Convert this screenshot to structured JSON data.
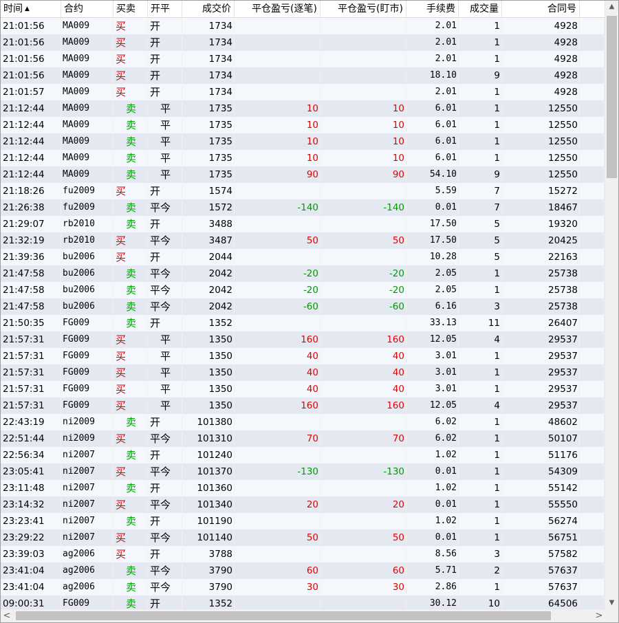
{
  "columns": {
    "time": "时间",
    "contract": "合约",
    "direction": "买卖",
    "offset": "开平",
    "price": "成交价",
    "pnl_trade": "平仓盈亏(逐笔)",
    "pnl_market": "平仓盈亏(盯市)",
    "fee": "手续费",
    "volume": "成交量",
    "contract_id": "合同号"
  },
  "sort": {
    "column": "time",
    "icon": "sort-ascending-icon",
    "glyph": "▲"
  },
  "icons": {
    "scroll_up": "▲",
    "scroll_down": "▼",
    "scroll_left": "<",
    "scroll_right": ">"
  },
  "colors": {
    "buy": "#d40000",
    "sell": "#00a000",
    "profit": "#e00000",
    "loss": "#009900"
  },
  "rows": [
    {
      "time": "21:01:56",
      "contract": "MA009",
      "direction": "买",
      "offset": "开",
      "price": "1734",
      "pnl_trade": "",
      "pnl_market": "",
      "fee": "2.01",
      "volume": "1",
      "contract_id": "4928"
    },
    {
      "time": "21:01:56",
      "contract": "MA009",
      "direction": "买",
      "offset": "开",
      "price": "1734",
      "pnl_trade": "",
      "pnl_market": "",
      "fee": "2.01",
      "volume": "1",
      "contract_id": "4928"
    },
    {
      "time": "21:01:56",
      "contract": "MA009",
      "direction": "买",
      "offset": "开",
      "price": "1734",
      "pnl_trade": "",
      "pnl_market": "",
      "fee": "2.01",
      "volume": "1",
      "contract_id": "4928"
    },
    {
      "time": "21:01:56",
      "contract": "MA009",
      "direction": "买",
      "offset": "开",
      "price": "1734",
      "pnl_trade": "",
      "pnl_market": "",
      "fee": "18.10",
      "volume": "9",
      "contract_id": "4928"
    },
    {
      "time": "21:01:57",
      "contract": "MA009",
      "direction": "买",
      "offset": "开",
      "price": "1734",
      "pnl_trade": "",
      "pnl_market": "",
      "fee": "2.01",
      "volume": "1",
      "contract_id": "4928"
    },
    {
      "time": "21:12:44",
      "contract": "MA009",
      "direction": "卖",
      "offset": "平",
      "price": "1735",
      "pnl_trade": "10",
      "pnl_market": "10",
      "fee": "6.01",
      "volume": "1",
      "contract_id": "12550"
    },
    {
      "time": "21:12:44",
      "contract": "MA009",
      "direction": "卖",
      "offset": "平",
      "price": "1735",
      "pnl_trade": "10",
      "pnl_market": "10",
      "fee": "6.01",
      "volume": "1",
      "contract_id": "12550"
    },
    {
      "time": "21:12:44",
      "contract": "MA009",
      "direction": "卖",
      "offset": "平",
      "price": "1735",
      "pnl_trade": "10",
      "pnl_market": "10",
      "fee": "6.01",
      "volume": "1",
      "contract_id": "12550"
    },
    {
      "time": "21:12:44",
      "contract": "MA009",
      "direction": "卖",
      "offset": "平",
      "price": "1735",
      "pnl_trade": "10",
      "pnl_market": "10",
      "fee": "6.01",
      "volume": "1",
      "contract_id": "12550"
    },
    {
      "time": "21:12:44",
      "contract": "MA009",
      "direction": "卖",
      "offset": "平",
      "price": "1735",
      "pnl_trade": "90",
      "pnl_market": "90",
      "fee": "54.10",
      "volume": "9",
      "contract_id": "12550"
    },
    {
      "time": "21:18:26",
      "contract": "fu2009",
      "direction": "买",
      "offset": "开",
      "price": "1574",
      "pnl_trade": "",
      "pnl_market": "",
      "fee": "5.59",
      "volume": "7",
      "contract_id": "15272"
    },
    {
      "time": "21:26:38",
      "contract": "fu2009",
      "direction": "卖",
      "offset": "平今",
      "price": "1572",
      "pnl_trade": "-140",
      "pnl_market": "-140",
      "fee": "0.01",
      "volume": "7",
      "contract_id": "18467"
    },
    {
      "time": "21:29:07",
      "contract": "rb2010",
      "direction": "卖",
      "offset": "开",
      "price": "3488",
      "pnl_trade": "",
      "pnl_market": "",
      "fee": "17.50",
      "volume": "5",
      "contract_id": "19320"
    },
    {
      "time": "21:32:19",
      "contract": "rb2010",
      "direction": "买",
      "offset": "平今",
      "price": "3487",
      "pnl_trade": "50",
      "pnl_market": "50",
      "fee": "17.50",
      "volume": "5",
      "contract_id": "20425"
    },
    {
      "time": "21:39:36",
      "contract": "bu2006",
      "direction": "买",
      "offset": "开",
      "price": "2044",
      "pnl_trade": "",
      "pnl_market": "",
      "fee": "10.28",
      "volume": "5",
      "contract_id": "22163"
    },
    {
      "time": "21:47:58",
      "contract": "bu2006",
      "direction": "卖",
      "offset": "平今",
      "price": "2042",
      "pnl_trade": "-20",
      "pnl_market": "-20",
      "fee": "2.05",
      "volume": "1",
      "contract_id": "25738"
    },
    {
      "time": "21:47:58",
      "contract": "bu2006",
      "direction": "卖",
      "offset": "平今",
      "price": "2042",
      "pnl_trade": "-20",
      "pnl_market": "-20",
      "fee": "2.05",
      "volume": "1",
      "contract_id": "25738"
    },
    {
      "time": "21:47:58",
      "contract": "bu2006",
      "direction": "卖",
      "offset": "平今",
      "price": "2042",
      "pnl_trade": "-60",
      "pnl_market": "-60",
      "fee": "6.16",
      "volume": "3",
      "contract_id": "25738"
    },
    {
      "time": "21:50:35",
      "contract": "FG009",
      "direction": "卖",
      "offset": "开",
      "price": "1352",
      "pnl_trade": "",
      "pnl_market": "",
      "fee": "33.13",
      "volume": "11",
      "contract_id": "26407"
    },
    {
      "time": "21:57:31",
      "contract": "FG009",
      "direction": "买",
      "offset": "平",
      "price": "1350",
      "pnl_trade": "160",
      "pnl_market": "160",
      "fee": "12.05",
      "volume": "4",
      "contract_id": "29537"
    },
    {
      "time": "21:57:31",
      "contract": "FG009",
      "direction": "买",
      "offset": "平",
      "price": "1350",
      "pnl_trade": "40",
      "pnl_market": "40",
      "fee": "3.01",
      "volume": "1",
      "contract_id": "29537"
    },
    {
      "time": "21:57:31",
      "contract": "FG009",
      "direction": "买",
      "offset": "平",
      "price": "1350",
      "pnl_trade": "40",
      "pnl_market": "40",
      "fee": "3.01",
      "volume": "1",
      "contract_id": "29537"
    },
    {
      "time": "21:57:31",
      "contract": "FG009",
      "direction": "买",
      "offset": "平",
      "price": "1350",
      "pnl_trade": "40",
      "pnl_market": "40",
      "fee": "3.01",
      "volume": "1",
      "contract_id": "29537"
    },
    {
      "time": "21:57:31",
      "contract": "FG009",
      "direction": "买",
      "offset": "平",
      "price": "1350",
      "pnl_trade": "160",
      "pnl_market": "160",
      "fee": "12.05",
      "volume": "4",
      "contract_id": "29537"
    },
    {
      "time": "22:43:19",
      "contract": "ni2009",
      "direction": "卖",
      "offset": "开",
      "price": "101380",
      "pnl_trade": "",
      "pnl_market": "",
      "fee": "6.02",
      "volume": "1",
      "contract_id": "48602"
    },
    {
      "time": "22:51:44",
      "contract": "ni2009",
      "direction": "买",
      "offset": "平今",
      "price": "101310",
      "pnl_trade": "70",
      "pnl_market": "70",
      "fee": "6.02",
      "volume": "1",
      "contract_id": "50107"
    },
    {
      "time": "22:56:34",
      "contract": "ni2007",
      "direction": "卖",
      "offset": "开",
      "price": "101240",
      "pnl_trade": "",
      "pnl_market": "",
      "fee": "1.02",
      "volume": "1",
      "contract_id": "51176"
    },
    {
      "time": "23:05:41",
      "contract": "ni2007",
      "direction": "买",
      "offset": "平今",
      "price": "101370",
      "pnl_trade": "-130",
      "pnl_market": "-130",
      "fee": "0.01",
      "volume": "1",
      "contract_id": "54309"
    },
    {
      "time": "23:11:48",
      "contract": "ni2007",
      "direction": "卖",
      "offset": "开",
      "price": "101360",
      "pnl_trade": "",
      "pnl_market": "",
      "fee": "1.02",
      "volume": "1",
      "contract_id": "55142"
    },
    {
      "time": "23:14:32",
      "contract": "ni2007",
      "direction": "买",
      "offset": "平今",
      "price": "101340",
      "pnl_trade": "20",
      "pnl_market": "20",
      "fee": "0.01",
      "volume": "1",
      "contract_id": "55550"
    },
    {
      "time": "23:23:41",
      "contract": "ni2007",
      "direction": "卖",
      "offset": "开",
      "price": "101190",
      "pnl_trade": "",
      "pnl_market": "",
      "fee": "1.02",
      "volume": "1",
      "contract_id": "56274"
    },
    {
      "time": "23:29:22",
      "contract": "ni2007",
      "direction": "买",
      "offset": "平今",
      "price": "101140",
      "pnl_trade": "50",
      "pnl_market": "50",
      "fee": "0.01",
      "volume": "1",
      "contract_id": "56751"
    },
    {
      "time": "23:39:03",
      "contract": "ag2006",
      "direction": "买",
      "offset": "开",
      "price": "3788",
      "pnl_trade": "",
      "pnl_market": "",
      "fee": "8.56",
      "volume": "3",
      "contract_id": "57582"
    },
    {
      "time": "23:41:04",
      "contract": "ag2006",
      "direction": "卖",
      "offset": "平今",
      "price": "3790",
      "pnl_trade": "60",
      "pnl_market": "60",
      "fee": "5.71",
      "volume": "2",
      "contract_id": "57637"
    },
    {
      "time": "23:41:04",
      "contract": "ag2006",
      "direction": "卖",
      "offset": "平今",
      "price": "3790",
      "pnl_trade": "30",
      "pnl_market": "30",
      "fee": "2.86",
      "volume": "1",
      "contract_id": "57637"
    },
    {
      "time": "09:00:31",
      "contract": "FG009",
      "direction": "卖",
      "offset": "开",
      "price": "1352",
      "pnl_trade": "",
      "pnl_market": "",
      "fee": "30.12",
      "volume": "10",
      "contract_id": "64506"
    }
  ]
}
